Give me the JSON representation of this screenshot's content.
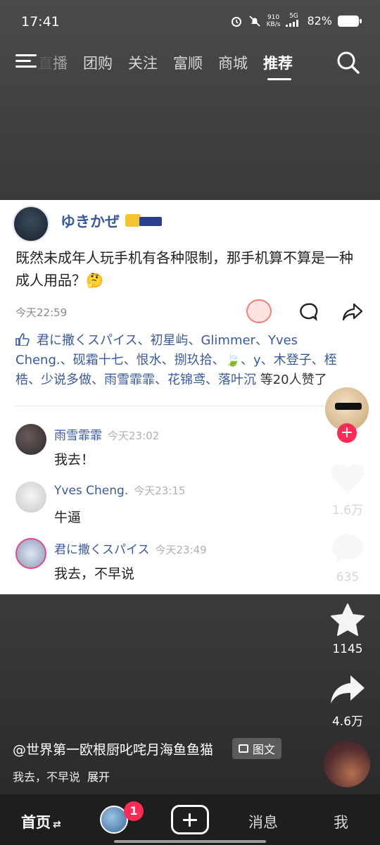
{
  "status_bar": {
    "time": "17:41",
    "network_speed": "910",
    "network_unit": "KB/s",
    "signal": "5G",
    "battery": "82%"
  },
  "top_nav": {
    "tabs": [
      {
        "label": "播",
        "clipped_prefix": "直"
      },
      {
        "label": "团购"
      },
      {
        "label": "关注"
      },
      {
        "label": "富顺"
      },
      {
        "label": "商城"
      },
      {
        "label": "推荐",
        "active": true
      }
    ]
  },
  "post": {
    "author": "ゆきかぜ",
    "text": "既然未成年人玩手机有各种限制，那手机算不算是一种成人用品？🤔",
    "time": "今天22:59",
    "likes_names": "君に撒くスパイス、初星屿、Glimmer、Yves Cheng.、砚霜十七、恨水、捌玖拾、🍃、y、木登子、桎梏、少说多做、雨雪霏霏、花锦鸢、落叶沉",
    "likes_suffix": "等20人赞了",
    "comments": [
      {
        "name": "雨雪霏霏",
        "time": "今天23:02",
        "text": "我去！"
      },
      {
        "name": "Yves Cheng.",
        "time": "今天23:15",
        "text": "牛逼"
      },
      {
        "name": "君に撒くスパイス",
        "time": "今天23:49",
        "text": "我去，不早说"
      }
    ]
  },
  "right_rail": {
    "follow": "+",
    "like_count": "1.6万",
    "comment_count": "635",
    "favorite_count": "1145",
    "share_count": "4.6万"
  },
  "caption": {
    "username": "@世界第一欧根厨叱咤月海鱼鱼猫",
    "chip": "图文",
    "description": "我去，不早说",
    "expand": "展开"
  },
  "bottom_nav": {
    "home": "首页",
    "home_swap": "⇄",
    "badge": "1",
    "messages": "消息",
    "me": "我"
  }
}
